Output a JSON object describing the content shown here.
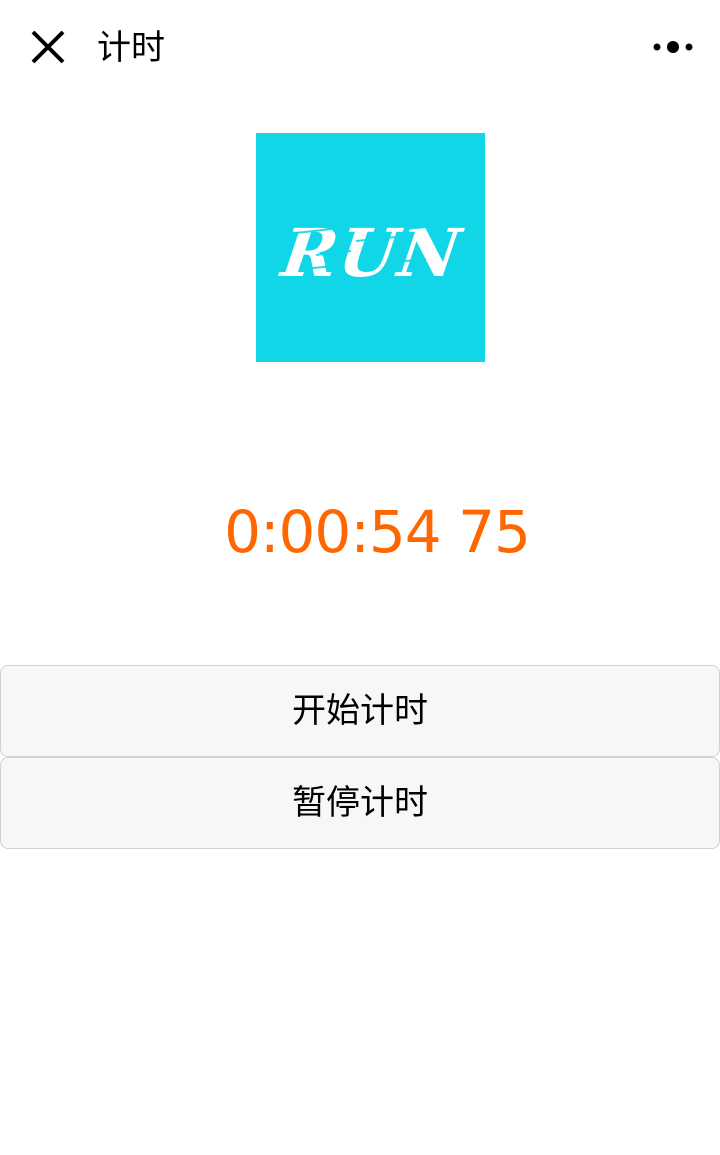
{
  "navbar": {
    "title": "计时",
    "close_icon": "close-icon",
    "more_icon": "more-dots-icon"
  },
  "logo": {
    "text": "RUN",
    "background_color": "#10d6e8",
    "text_color": "#ffffff"
  },
  "timer": {
    "display": "0:00:54 75",
    "color": "#ff6600"
  },
  "buttons": {
    "start_label": "开始计时",
    "pause_label": "暂停计时"
  }
}
